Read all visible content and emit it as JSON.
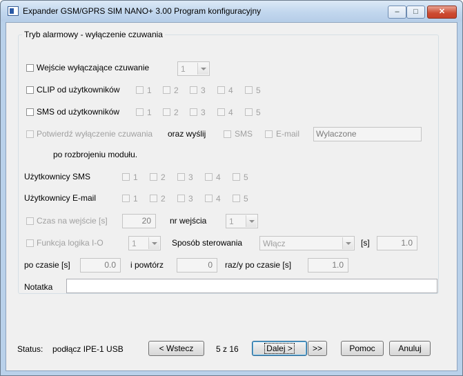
{
  "window": {
    "title": "Expander GSM/GPRS SIM NANO+ 3.00 Program konfiguracyjny"
  },
  "group": {
    "legend": "Tryb alarmowy - wyłączenie czuwania"
  },
  "row1": {
    "label": "Wejście wyłączające czuwanie",
    "combo_value": "1"
  },
  "row2": {
    "label": "CLIP od użytkowników",
    "opts": [
      "1",
      "2",
      "3",
      "4",
      "5"
    ]
  },
  "row3": {
    "label": "SMS od użytkowników",
    "opts": [
      "1",
      "2",
      "3",
      "4",
      "5"
    ]
  },
  "row4": {
    "label": "Potwierdź wyłączenie czuwania",
    "and_send": "oraz wyślij",
    "sms": "SMS",
    "email": "E-mail",
    "status_value": "Wylaczone",
    "after": "po rozbrojeniu modułu."
  },
  "row5": {
    "label": "Użytkownicy SMS",
    "opts": [
      "1",
      "2",
      "3",
      "4",
      "5"
    ]
  },
  "row6": {
    "label": "Użytkownicy E-mail",
    "opts": [
      "1",
      "2",
      "3",
      "4",
      "5"
    ]
  },
  "row7": {
    "label": "Czas na wejście [s]",
    "value": "20",
    "input_label": "nr wejścia",
    "input_value": "1"
  },
  "row8": {
    "label": "Funkcja logika I-O",
    "func_value": "1",
    "control_label": "Sposób sterowania",
    "control_value": "Włącz",
    "s_label": "[s]",
    "s_value": "1.0"
  },
  "row9": {
    "after_label": "po czasie [s]",
    "after_value": "0.0",
    "repeat_label": "i powtórz",
    "repeat_value": "0",
    "times_label": "raz/y po czasie [s]",
    "times_value": "1.0"
  },
  "note": {
    "label": "Notatka",
    "value": ""
  },
  "footer": {
    "status_label": "Status:",
    "status_value": "podłącz IPE-1 USB",
    "back": "< Wstecz",
    "page": "5 z 16",
    "next": "Dalej >",
    "skip": ">>",
    "help": "Pomoc",
    "cancel": "Anuluj"
  }
}
